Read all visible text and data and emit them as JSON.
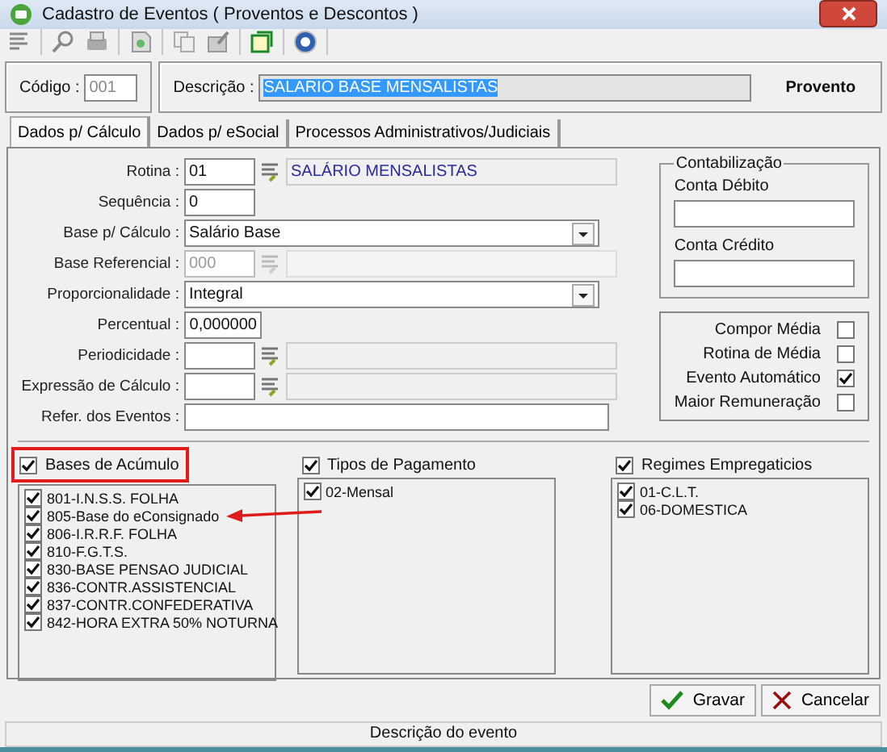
{
  "window": {
    "title": "Cadastro de Eventos ( Proventos e Descontos )"
  },
  "header": {
    "code_label": "Código :",
    "code_value": "001",
    "description_label": "Descrição :",
    "description_value": "SALARIO BASE MENSALISTAS",
    "type": "Provento"
  },
  "tabs": [
    {
      "label": "Dados p/ Cálculo",
      "selected": true
    },
    {
      "label": "Dados p/ eSocial",
      "selected": false
    },
    {
      "label": "Processos Administrativos/Judiciais",
      "selected": false
    }
  ],
  "fields": [
    {
      "kind": "lookup",
      "label": "Rotina :",
      "value": "01",
      "description": "SALÁRIO MENSALISTAS",
      "disabled": false
    },
    {
      "kind": "short",
      "label": "Sequência :",
      "value": "0"
    },
    {
      "kind": "select",
      "label": "Base p/ Cálculo :",
      "value": "Salário Base"
    },
    {
      "kind": "lookup",
      "label": "Base Referencial :",
      "value": "000",
      "disabled": true
    },
    {
      "kind": "select",
      "label": "Proporcionalidade :",
      "value": "Integral"
    },
    {
      "kind": "number",
      "label": "Percentual :",
      "value": "0,000000"
    },
    {
      "kind": "lookup",
      "label": "Periodicidade :",
      "disabled": false
    },
    {
      "kind": "lookup",
      "label": "Expressão de Cálculo :",
      "disabled": false
    },
    {
      "kind": "wide",
      "label": "Refer. dos Eventos :"
    }
  ],
  "accounting": {
    "title": "Contabilização",
    "fields": [
      {
        "label": "Conta Débito"
      },
      {
        "label": "Conta Crédito"
      }
    ]
  },
  "options": [
    {
      "label": "Compor Média",
      "checked": false
    },
    {
      "label": "Rotina de Média",
      "checked": false
    },
    {
      "label": "Evento Automático",
      "checked": true
    },
    {
      "label": "Maior Remuneração",
      "checked": false
    }
  ],
  "lists": [
    {
      "title": "Bases de Acúmulo",
      "checked": true,
      "highlighted": true,
      "items": [
        {
          "label": "801-I.N.S.S. FOLHA",
          "checked": true
        },
        {
          "label": "805-Base do eConsignado",
          "checked": true,
          "pointed": true
        },
        {
          "label": "806-I.R.R.F. FOLHA",
          "checked": true
        },
        {
          "label": "810-F.G.T.S.",
          "checked": true
        },
        {
          "label": "830-BASE PENSAO JUDICIAL",
          "checked": true
        },
        {
          "label": "836-CONTR.ASSISTENCIAL",
          "checked": true
        },
        {
          "label": "837-CONTR.CONFEDERATIVA",
          "checked": true
        },
        {
          "label": "842-HORA EXTRA 50% NOTURNA",
          "checked": true
        }
      ]
    },
    {
      "title": "Tipos de Pagamento",
      "checked": true,
      "highlighted": false,
      "items": [
        {
          "label": "02-Mensal",
          "checked": true
        }
      ]
    },
    {
      "title": "Regimes Empregaticios",
      "checked": true,
      "highlighted": false,
      "items": [
        {
          "label": "01-C.L.T.",
          "checked": true
        },
        {
          "label": "06-DOMESTICA",
          "checked": true
        }
      ]
    }
  ],
  "buttons": [
    {
      "kind": "save",
      "label": "Gravar"
    },
    {
      "kind": "cancel",
      "label": "Cancelar"
    }
  ],
  "status_bar": "Descrição do evento"
}
